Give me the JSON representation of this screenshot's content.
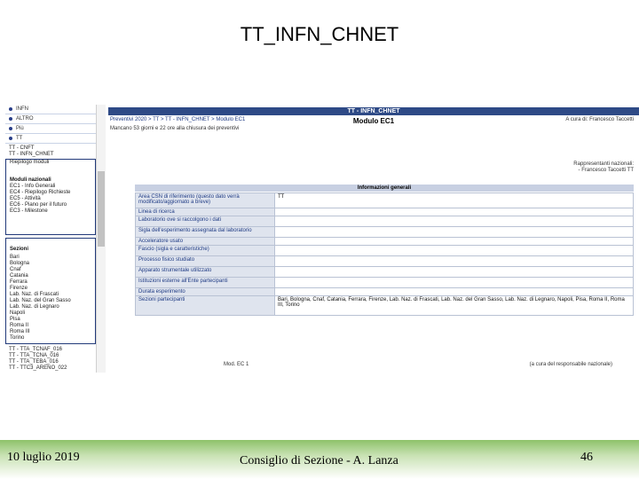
{
  "slide": {
    "title": "TT_INFN_CHNET"
  },
  "sidebar": {
    "nav": [
      "INFN",
      "ALTRO",
      "Più",
      "TT"
    ],
    "tree": [
      "TT - CNFT",
      "TT - INFN_CHNET"
    ],
    "riepilogo": "Riepilogo moduli",
    "moduli_title": "Moduli nazionali",
    "moduli": [
      "EC1 - Info Generali",
      "EC4 - Riepilogo Richieste",
      "EC5 - Attività",
      "EC6 - Piano per il futuro",
      "EC3 - Milestone"
    ],
    "sezioni_title": "Sezioni",
    "sezioni": [
      "Bari",
      "Bologna",
      "Cnaf",
      "Catania",
      "Ferrara",
      "Firenze",
      "Lab. Naz. di Frascati",
      "Lab. Naz. del Gran Sasso",
      "Lab. Naz. di Legnaro",
      "Napoli",
      "Pisa",
      "Roma II",
      "Roma III",
      "Torino"
    ],
    "tt_items": [
      "TT - TTA_TCNAF_016",
      "TT - TTA_TCNA_016",
      "TT - TTA_TEBA_016",
      "TT - TTC3_ARENO_022"
    ]
  },
  "main": {
    "topbar": "TT - INFN_CHNET",
    "breadcrumb": "Preventivi 2020 > TT > TT - INFN_CHNET > Modulo EC1",
    "title": "Modulo EC1",
    "acura": "A cura di: Francesco Taccetti",
    "deadline": "Mancano 53 giorni e 22 ore alla chiusura dei preventivi",
    "rappresentanti": [
      "Rappresentanti nazionali:",
      "- Francesco Taccetti TT"
    ],
    "info_header": "Informazioni generali",
    "rows": [
      {
        "label": "Area CSN di riferimento (questo dato verrà modificato/aggiornato a breve)",
        "value": "TT"
      },
      {
        "label": "Linea di ricerca",
        "value": ""
      },
      {
        "label": "Laboratorio ove si raccolgono i dati",
        "value": ""
      },
      {
        "label": "Sigla dell'esperimento assegnata dal laboratorio",
        "value": ""
      },
      {
        "label": "Acceleratore usato",
        "value": ""
      },
      {
        "label": "Fascio (sigla e caratteristiche)",
        "value": ""
      },
      {
        "label": "Processo fisico studiato",
        "value": ""
      },
      {
        "label": "Apparato strumentale utilizzato",
        "value": ""
      },
      {
        "label": "Istituzioni esterne all'Ente partecipanti",
        "value": ""
      },
      {
        "label": "Durata esperimento",
        "value": ""
      },
      {
        "label": "Sezioni partecipanti",
        "value": "Bari, Bologna, Cnaf, Catania, Ferrara, Firenze, Lab. Naz. di Frascati, Lab. Naz. del Gran Sasso, Lab. Naz. di Legnaro, Napoli, Pisa, Roma II, Roma III, Torino"
      }
    ],
    "footer_left": "Mod. EC 1",
    "footer_right": "(a cura del responsabile nazionale)"
  },
  "footer": {
    "date": "10 luglio 2019",
    "center": "Consiglio di Sezione - A. Lanza",
    "page": "46"
  }
}
